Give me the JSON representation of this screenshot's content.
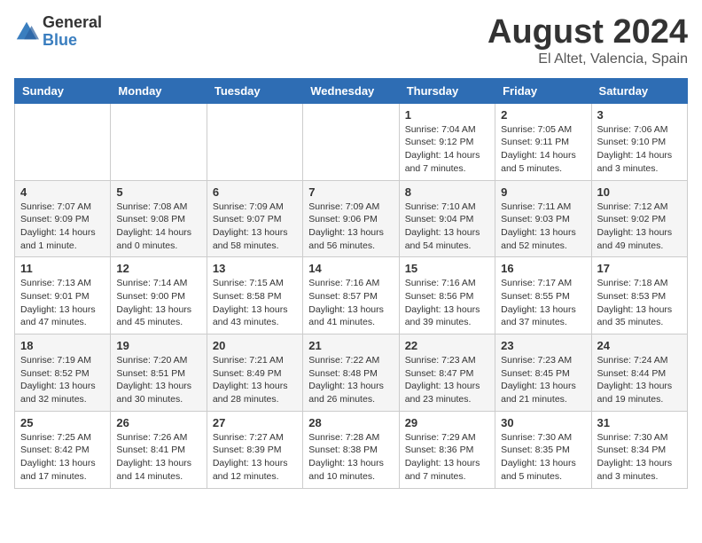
{
  "logo": {
    "text_general": "General",
    "text_blue": "Blue"
  },
  "title": "August 2024",
  "subtitle": "El Altet, Valencia, Spain",
  "headers": [
    "Sunday",
    "Monday",
    "Tuesday",
    "Wednesday",
    "Thursday",
    "Friday",
    "Saturday"
  ],
  "weeks": [
    [
      {
        "day": "",
        "info": ""
      },
      {
        "day": "",
        "info": ""
      },
      {
        "day": "",
        "info": ""
      },
      {
        "day": "",
        "info": ""
      },
      {
        "day": "1",
        "info": "Sunrise: 7:04 AM\nSunset: 9:12 PM\nDaylight: 14 hours\nand 7 minutes."
      },
      {
        "day": "2",
        "info": "Sunrise: 7:05 AM\nSunset: 9:11 PM\nDaylight: 14 hours\nand 5 minutes."
      },
      {
        "day": "3",
        "info": "Sunrise: 7:06 AM\nSunset: 9:10 PM\nDaylight: 14 hours\nand 3 minutes."
      }
    ],
    [
      {
        "day": "4",
        "info": "Sunrise: 7:07 AM\nSunset: 9:09 PM\nDaylight: 14 hours\nand 1 minute."
      },
      {
        "day": "5",
        "info": "Sunrise: 7:08 AM\nSunset: 9:08 PM\nDaylight: 14 hours\nand 0 minutes."
      },
      {
        "day": "6",
        "info": "Sunrise: 7:09 AM\nSunset: 9:07 PM\nDaylight: 13 hours\nand 58 minutes."
      },
      {
        "day": "7",
        "info": "Sunrise: 7:09 AM\nSunset: 9:06 PM\nDaylight: 13 hours\nand 56 minutes."
      },
      {
        "day": "8",
        "info": "Sunrise: 7:10 AM\nSunset: 9:04 PM\nDaylight: 13 hours\nand 54 minutes."
      },
      {
        "day": "9",
        "info": "Sunrise: 7:11 AM\nSunset: 9:03 PM\nDaylight: 13 hours\nand 52 minutes."
      },
      {
        "day": "10",
        "info": "Sunrise: 7:12 AM\nSunset: 9:02 PM\nDaylight: 13 hours\nand 49 minutes."
      }
    ],
    [
      {
        "day": "11",
        "info": "Sunrise: 7:13 AM\nSunset: 9:01 PM\nDaylight: 13 hours\nand 47 minutes."
      },
      {
        "day": "12",
        "info": "Sunrise: 7:14 AM\nSunset: 9:00 PM\nDaylight: 13 hours\nand 45 minutes."
      },
      {
        "day": "13",
        "info": "Sunrise: 7:15 AM\nSunset: 8:58 PM\nDaylight: 13 hours\nand 43 minutes."
      },
      {
        "day": "14",
        "info": "Sunrise: 7:16 AM\nSunset: 8:57 PM\nDaylight: 13 hours\nand 41 minutes."
      },
      {
        "day": "15",
        "info": "Sunrise: 7:16 AM\nSunset: 8:56 PM\nDaylight: 13 hours\nand 39 minutes."
      },
      {
        "day": "16",
        "info": "Sunrise: 7:17 AM\nSunset: 8:55 PM\nDaylight: 13 hours\nand 37 minutes."
      },
      {
        "day": "17",
        "info": "Sunrise: 7:18 AM\nSunset: 8:53 PM\nDaylight: 13 hours\nand 35 minutes."
      }
    ],
    [
      {
        "day": "18",
        "info": "Sunrise: 7:19 AM\nSunset: 8:52 PM\nDaylight: 13 hours\nand 32 minutes."
      },
      {
        "day": "19",
        "info": "Sunrise: 7:20 AM\nSunset: 8:51 PM\nDaylight: 13 hours\nand 30 minutes."
      },
      {
        "day": "20",
        "info": "Sunrise: 7:21 AM\nSunset: 8:49 PM\nDaylight: 13 hours\nand 28 minutes."
      },
      {
        "day": "21",
        "info": "Sunrise: 7:22 AM\nSunset: 8:48 PM\nDaylight: 13 hours\nand 26 minutes."
      },
      {
        "day": "22",
        "info": "Sunrise: 7:23 AM\nSunset: 8:47 PM\nDaylight: 13 hours\nand 23 minutes."
      },
      {
        "day": "23",
        "info": "Sunrise: 7:23 AM\nSunset: 8:45 PM\nDaylight: 13 hours\nand 21 minutes."
      },
      {
        "day": "24",
        "info": "Sunrise: 7:24 AM\nSunset: 8:44 PM\nDaylight: 13 hours\nand 19 minutes."
      }
    ],
    [
      {
        "day": "25",
        "info": "Sunrise: 7:25 AM\nSunset: 8:42 PM\nDaylight: 13 hours\nand 17 minutes."
      },
      {
        "day": "26",
        "info": "Sunrise: 7:26 AM\nSunset: 8:41 PM\nDaylight: 13 hours\nand 14 minutes."
      },
      {
        "day": "27",
        "info": "Sunrise: 7:27 AM\nSunset: 8:39 PM\nDaylight: 13 hours\nand 12 minutes."
      },
      {
        "day": "28",
        "info": "Sunrise: 7:28 AM\nSunset: 8:38 PM\nDaylight: 13 hours\nand 10 minutes."
      },
      {
        "day": "29",
        "info": "Sunrise: 7:29 AM\nSunset: 8:36 PM\nDaylight: 13 hours\nand 7 minutes."
      },
      {
        "day": "30",
        "info": "Sunrise: 7:30 AM\nSunset: 8:35 PM\nDaylight: 13 hours\nand 5 minutes."
      },
      {
        "day": "31",
        "info": "Sunrise: 7:30 AM\nSunset: 8:34 PM\nDaylight: 13 hours\nand 3 minutes."
      }
    ]
  ]
}
